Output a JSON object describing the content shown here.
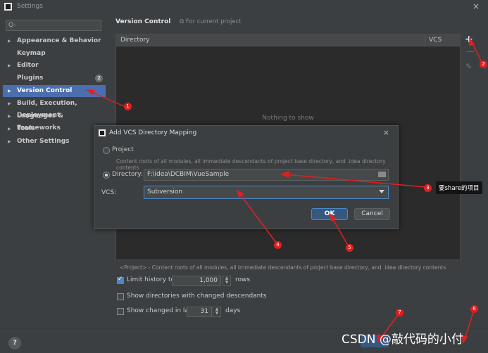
{
  "window": {
    "title": "Settings",
    "close": "×"
  },
  "sidebar": {
    "search_icon": "Q-",
    "items": [
      {
        "label": "Appearance & Behavior",
        "arrow": "▶",
        "selected": false
      },
      {
        "label": "Keymap",
        "arrow": "",
        "selected": false
      },
      {
        "label": "Editor",
        "arrow": "▶",
        "selected": false
      },
      {
        "label": "Plugins",
        "arrow": "",
        "selected": false,
        "badge": "2"
      },
      {
        "label": "Version Control",
        "arrow": "▶",
        "selected": true
      },
      {
        "label": "Build, Execution, Deployment",
        "arrow": "▶",
        "selected": false
      },
      {
        "label": "Languages & Frameworks",
        "arrow": "▶",
        "selected": false
      },
      {
        "label": "Tools",
        "arrow": "▶",
        "selected": false
      },
      {
        "label": "Other Settings",
        "arrow": "▶",
        "selected": false
      }
    ]
  },
  "main": {
    "title": "Version Control",
    "for_project": "For current project",
    "table": {
      "columns": [
        "Directory",
        "VCS"
      ],
      "empty_text": "Nothing to show"
    },
    "tools": {
      "add": "+",
      "remove": "—",
      "edit": "✎"
    },
    "note": "<Project> - Content roots of all modules, all immediate descendants of project base directory, and .idea directory contents",
    "limit_history": {
      "label": "Limit history to:",
      "checked": true,
      "value": "1,000",
      "unit": "rows"
    },
    "show_changed_dirs": {
      "label": "Show directories with changed descendants",
      "checked": false
    },
    "show_changed_last": {
      "label": "Show changed in last",
      "checked": false,
      "value": "31",
      "unit": "days"
    }
  },
  "dialog": {
    "title": "Add VCS Directory Mapping",
    "close": "×",
    "project_option": {
      "label": "Project",
      "selected": false
    },
    "project_desc": "Content roots of all modules, all immediate descendants of project base directory, and .idea directory contents",
    "directory_option": {
      "label": "Directory:",
      "selected": true,
      "value": "F:\\idea\\DCBIM\\VueSample"
    },
    "vcs_label": "VCS:",
    "vcs_value": "Subversion",
    "ok_label": "OK",
    "cancel_label": "Cancel"
  },
  "footer": {
    "help": "?"
  },
  "annotations": {
    "markers": [
      "1",
      "2",
      "3",
      "4",
      "5",
      "6",
      "7"
    ],
    "share_label": "要share的项目",
    "watermark": "CSDN @敲代码的小付",
    "color": "#e02020"
  }
}
